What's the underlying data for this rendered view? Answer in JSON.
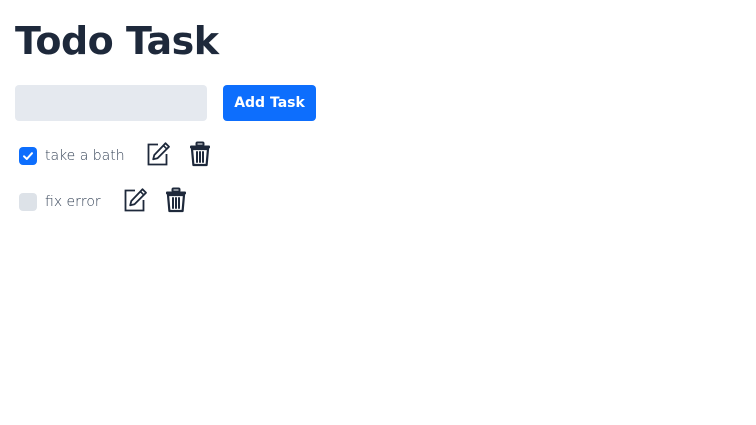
{
  "header": {
    "title": "Todo Task"
  },
  "form": {
    "input_value": "",
    "input_placeholder": "",
    "add_button_label": "Add Task"
  },
  "tasks": [
    {
      "label": "take a bath",
      "completed": true,
      "edit_icon": "edit-icon",
      "delete_icon": "trash-icon"
    },
    {
      "label": "fix error",
      "completed": false,
      "edit_icon": "edit-icon",
      "delete_icon": "trash-icon"
    }
  ],
  "colors": {
    "accent": "#0d6efd",
    "title": "#1e293b",
    "input_bg": "#e5e9ef",
    "checkbox_unchecked": "#dde2e8"
  }
}
